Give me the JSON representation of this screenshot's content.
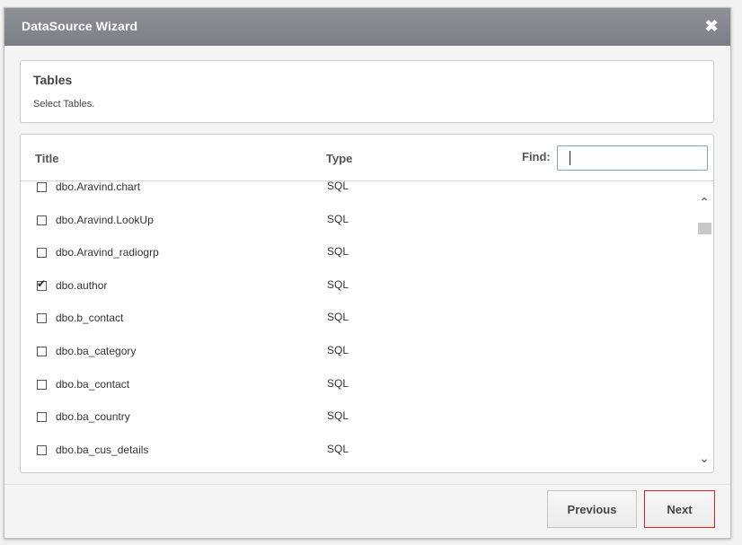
{
  "dialog": {
    "title": "DataSource Wizard",
    "close_glyph": "✖"
  },
  "tables": {
    "title": "Tables",
    "subtitle": "Select Tables."
  },
  "list": {
    "header": {
      "title": "Title",
      "type": "Type",
      "find_label": "Find:",
      "find_value": ""
    },
    "rows": [
      {
        "title": "dbo.Aravind.chart",
        "type": "SQL",
        "checked": false
      },
      {
        "title": "dbo.Aravind.LookUp",
        "type": "SQL",
        "checked": false
      },
      {
        "title": "dbo.Aravind_radiogrp",
        "type": "SQL",
        "checked": false
      },
      {
        "title": "dbo.author",
        "type": "SQL",
        "checked": true
      },
      {
        "title": "dbo.b_contact",
        "type": "SQL",
        "checked": false
      },
      {
        "title": "dbo.ba_category",
        "type": "SQL",
        "checked": false
      },
      {
        "title": "dbo.ba_contact",
        "type": "SQL",
        "checked": false
      },
      {
        "title": "dbo.ba_country",
        "type": "SQL",
        "checked": false
      },
      {
        "title": "dbo.ba_cus_details",
        "type": "SQL",
        "checked": false
      },
      {
        "title": "",
        "type": "",
        "checked": false
      }
    ],
    "scroll_up_glyph": "⌃",
    "scroll_down_glyph": "⌄"
  },
  "footer": {
    "previous_label": "Previous",
    "next_label": "Next"
  }
}
